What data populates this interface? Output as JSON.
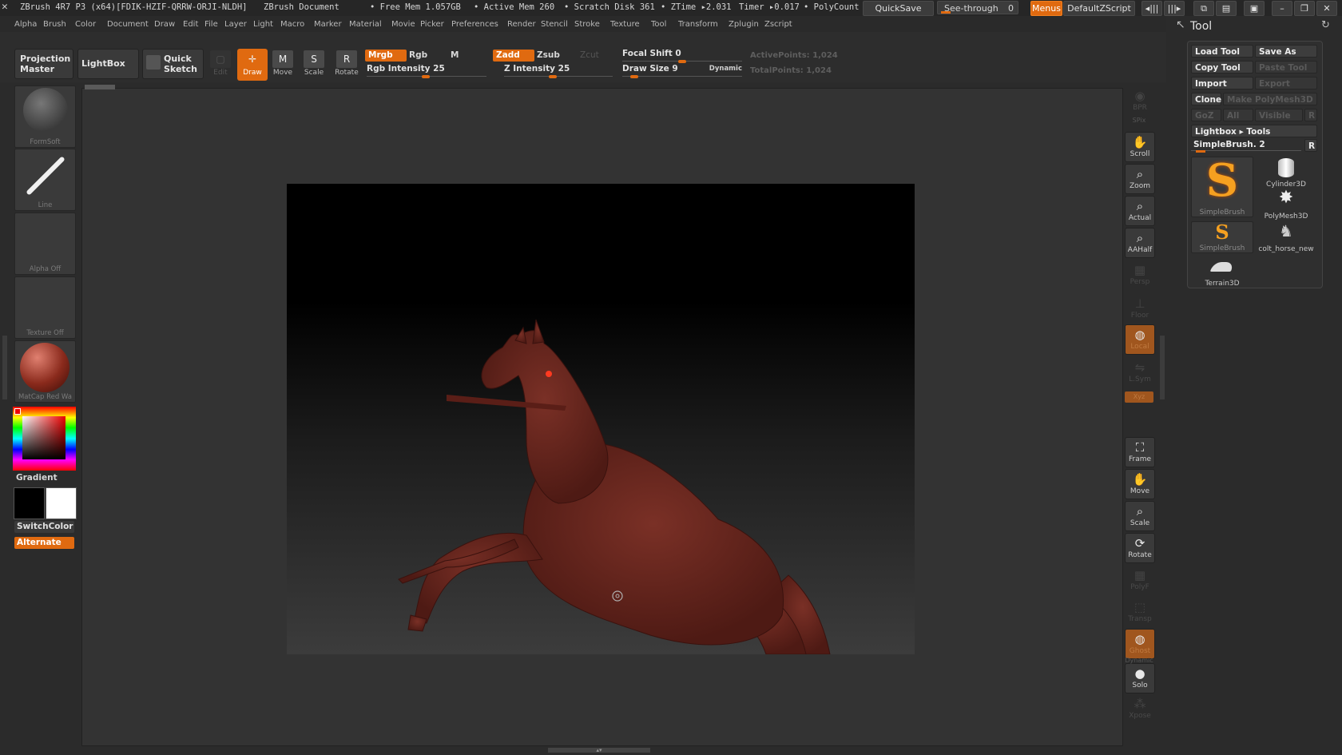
{
  "titlebar": {
    "app": "ZBrush 4R7 P3 (x64)[FDIK-HZIF-QRRW-ORJI-NLDH]",
    "document": "ZBrush Document",
    "free_mem": "• Free Mem 1.057GB",
    "active_mem": "• Active Mem 260",
    "scratch": "• Scratch Disk 361",
    "ztime": "• ZTime ▸2.031",
    "timer": "Timer ▸0.017",
    "polycount": "• PolyCount",
    "quicksave": "QuickSave",
    "seethrough": "See-through",
    "seethrough_value": "0",
    "menus": "Menus",
    "script": "DefaultZScript"
  },
  "menu": [
    "Alpha",
    "Brush",
    "Color",
    "Document",
    "Draw",
    "Edit",
    "File",
    "Layer",
    "Light",
    "Macro",
    "Marker",
    "Material",
    "Movie",
    "Picker",
    "Preferences",
    "Render",
    "Stencil",
    "Stroke",
    "Texture",
    "Tool",
    "Transform",
    "Zplugin",
    "Zscript"
  ],
  "shelf": {
    "projection_master_1": "Projection",
    "projection_master_2": "Master",
    "lightbox": "LightBox",
    "quick_sketch_1": "Quick",
    "quick_sketch_2": "Sketch",
    "edit": "Edit",
    "draw": "Draw",
    "move": "Move",
    "scale": "Scale",
    "rotate": "Rotate",
    "mrgb": "Mrgb",
    "rgb": "Rgb",
    "m": "M",
    "rgb_intensity": "Rgb Intensity 25",
    "rgb_intensity_value": 25,
    "zadd": "Zadd",
    "zsub": "Zsub",
    "zcut": "Zcut",
    "z_intensity": "Z Intensity 25",
    "z_intensity_value": 25,
    "focal_shift": "Focal Shift 0",
    "focal_shift_value": 0,
    "draw_size": "Draw Size 9",
    "draw_size_value": 9,
    "dynamic": "Dynamic",
    "active_points": "ActivePoints: 1,024",
    "total_points": "TotalPoints: 1,024"
  },
  "left": {
    "brush_caption": "FormSoft",
    "stroke_caption": "Line",
    "alpha_caption": "Alpha Off",
    "texture_caption": "Texture Off",
    "material_caption": "MatCap Red Wa",
    "gradient": "Gradient",
    "switchcolor": "SwitchColor",
    "alternate": "Alternate"
  },
  "right": {
    "bpr": "BPR",
    "spix": "SPix",
    "scroll": "Scroll",
    "zoom": "Zoom",
    "actual": "Actual",
    "aahalf": "AAHalf",
    "persp": "Persp",
    "floor": "Floor",
    "local": "Local",
    "lsym": "L.Sym",
    "xyz": "Xyz",
    "frame": "Frame",
    "move": "Move",
    "scale": "Scale",
    "rotate": "Rotate",
    "polyf": "PolyF",
    "transp": "Transp",
    "ghost": "Ghost",
    "dynamic": "Dynamic",
    "solo": "Solo",
    "xpose": "Xpose"
  },
  "tool": {
    "title": "Tool",
    "load_tool": "Load Tool",
    "save_as": "Save As",
    "copy_tool": "Copy Tool",
    "paste_tool": "Paste Tool",
    "import": "Import",
    "export": "Export",
    "clone": "Clone",
    "make_polymesh": "Make PolyMesh3D",
    "goz": "GoZ",
    "all": "All",
    "visible": "Visible",
    "r": "R",
    "lightbox_tools": "Lightbox ▸ Tools",
    "current": "SimpleBrush. 2",
    "r2": "R",
    "thumbs": [
      "SimpleBrush",
      "Cylinder3D",
      "PolyMesh3D",
      "SimpleBrush",
      "colt_horse_new",
      "Terrain3D"
    ]
  },
  "colors": {
    "accent": "#e06a10",
    "bg": "#2b2b2b",
    "model": "#6e2a22"
  }
}
